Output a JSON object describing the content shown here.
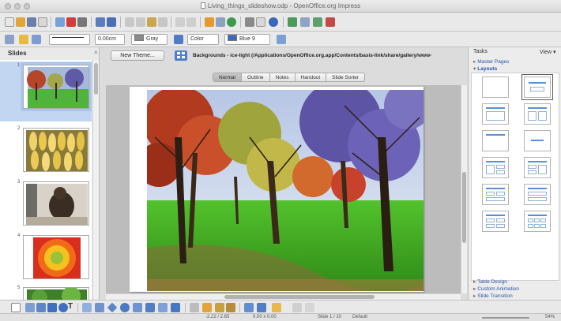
{
  "window": {
    "title": "Living_things_slideshow.odp - OpenOffice.org Impress"
  },
  "format_toolbar": {
    "line_width": "0.00cm",
    "line_color": "Gray",
    "area_style": "Color",
    "area_color": "Blue 9"
  },
  "slides_panel": {
    "title": "Slides",
    "close": "×",
    "slides": [
      {
        "number": "1",
        "subject": "autumn trees"
      },
      {
        "number": "2",
        "subject": "bananas"
      },
      {
        "number": "3",
        "subject": "bear"
      },
      {
        "number": "4",
        "subject": "flower"
      },
      {
        "number": "5",
        "subject": "bird"
      }
    ]
  },
  "main": {
    "new_theme_label": "New Theme...",
    "background_path": "Backgrounds - ice-light (/Applications/OpenOffice.org.app/Contents/basis-link/share/gallery/www-",
    "view_tabs": [
      "Normal",
      "Outline",
      "Notes",
      "Handout",
      "Slide Sorter"
    ],
    "active_tab": "Normal"
  },
  "tasks_panel": {
    "title": "Tasks",
    "view_label": "View ▾",
    "master_pages": "Master Pages",
    "layouts": "Layouts",
    "table_design": "Table Design",
    "custom_animation": "Custom Animation",
    "slide_transition": "Slide Transition"
  },
  "status_bar": {
    "position": "-2.22 / 2.65",
    "size": "0.00 x 0.00",
    "slide_info": "Slide 1 / 10",
    "layout_name": "Default",
    "zoom": "54%"
  },
  "colors": {
    "selection": "#c2d6f1",
    "link_blue": "#2a55a8",
    "accent_blue": "#4d7fd0"
  }
}
